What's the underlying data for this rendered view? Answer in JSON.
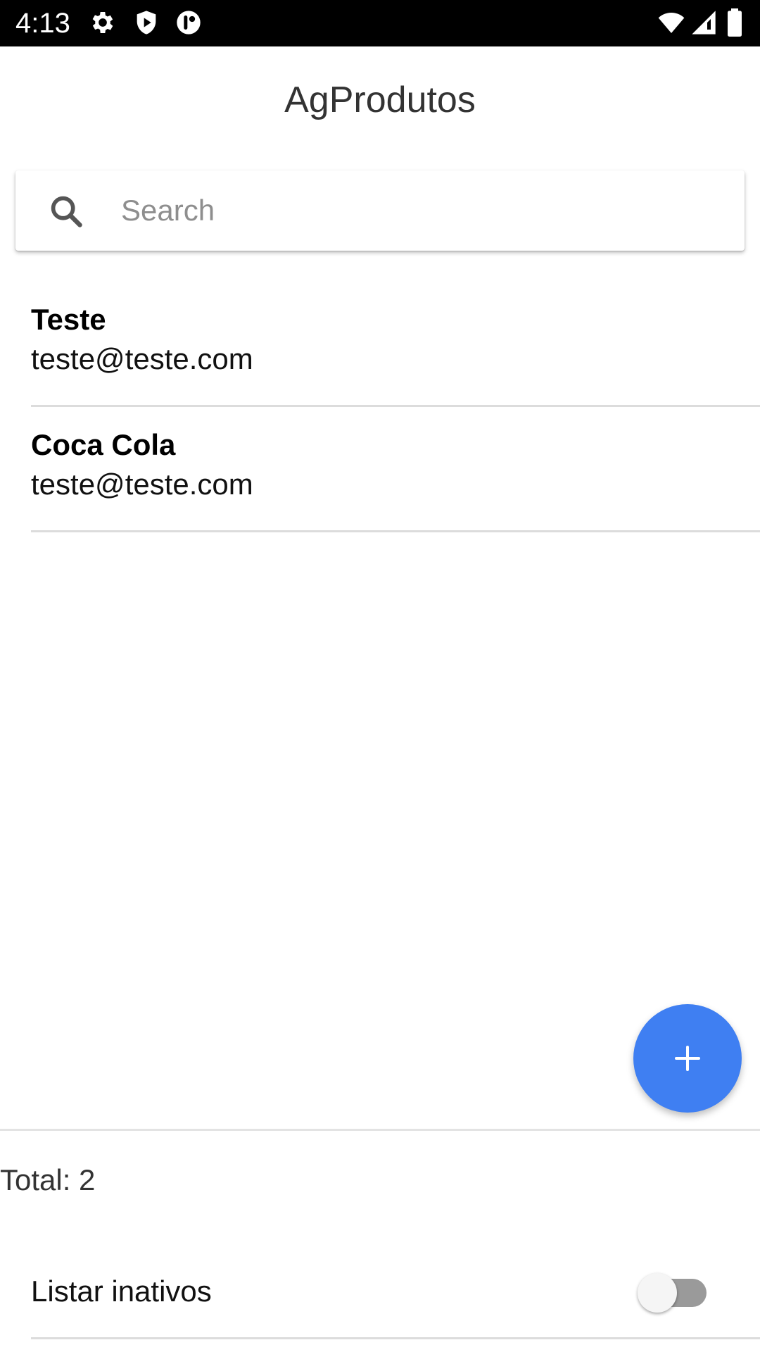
{
  "status_bar": {
    "time": "4:13",
    "left_icons": [
      "gear-icon",
      "shield-play-icon",
      "alert-badge-icon"
    ],
    "right_icons": [
      "wifi-icon",
      "cell-signal-icon",
      "battery-icon"
    ]
  },
  "header": {
    "title": "AgProdutos"
  },
  "search": {
    "placeholder": "Search",
    "value": ""
  },
  "list": {
    "items": [
      {
        "name": "Teste",
        "email": "teste@teste.com"
      },
      {
        "name": "Coca Cola",
        "email": "teste@teste.com"
      }
    ]
  },
  "fab": {
    "icon": "plus-icon",
    "color": "#3f7ff2"
  },
  "footer": {
    "total": "Total: 2",
    "toggle_label": "Listar inativos",
    "toggle_on": false
  }
}
